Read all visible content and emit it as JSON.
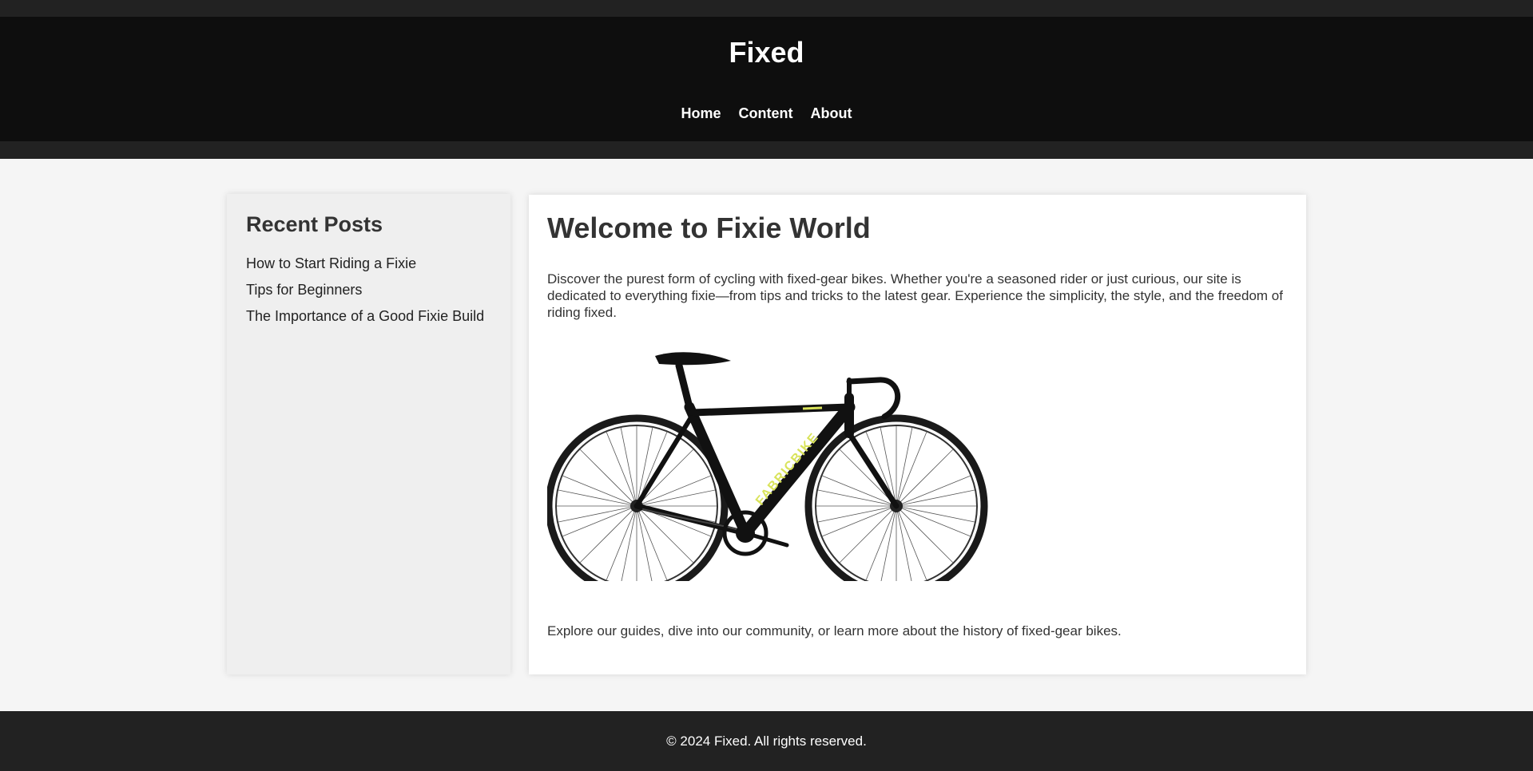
{
  "site": {
    "title": "Fixed"
  },
  "nav": {
    "items": [
      {
        "label": "Home"
      },
      {
        "label": "Content"
      },
      {
        "label": "About"
      }
    ]
  },
  "sidebar": {
    "heading": "Recent Posts",
    "posts": [
      {
        "label": "How to Start Riding a Fixie"
      },
      {
        "label": "Tips for Beginners"
      },
      {
        "label": "The Importance of a Good Fixie Build"
      }
    ]
  },
  "main": {
    "heading": "Welcome to Fixie World",
    "intro": "Discover the purest form of cycling with fixed-gear bikes. Whether you're a seasoned rider or just curious, our site is dedicated to everything fixie—from tips and tricks to the latest gear. Experience the simplicity, the style, and the freedom of riding fixed.",
    "image": {
      "frame_brand": "FABRICBIKE"
    },
    "outro": "Explore our guides, dive into our community, or learn more about the history of fixed-gear bikes."
  },
  "footer": {
    "copyright": "© 2024 Fixed. All rights reserved."
  },
  "colors": {
    "header_bg": "#0e0e0e",
    "band_bg": "#222222",
    "page_bg": "#f5f5f5",
    "sidebar_bg": "#efefef",
    "content_bg": "#ffffff",
    "text": "#333333",
    "brand_accent": "#d9e35a"
  }
}
